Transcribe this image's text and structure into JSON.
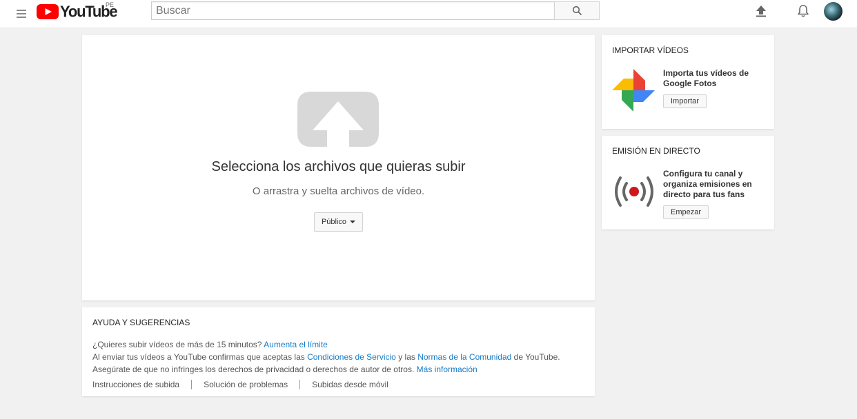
{
  "header": {
    "logo_text": "YouTube",
    "country_code": "PE",
    "search_placeholder": "Buscar",
    "search_value": ""
  },
  "upload": {
    "title": "Selecciona los archivos que quieras subir",
    "subtitle": "O arrastra y suelta archivos de vídeo.",
    "privacy_label": "Público"
  },
  "help": {
    "heading": "AYUDA Y SUGERENCIAS",
    "line1_text": "¿Quieres subir vídeos de más de 15 minutos?",
    "line1_link": "Aumenta el límite",
    "line2_a": "Al enviar tus vídeos a YouTube confirmas que aceptas las",
    "line2_link1": "Condiciones de Servicio",
    "line2_b": "y las",
    "line2_link2": "Normas de la Comunidad",
    "line2_c": "de YouTube.",
    "line3_text": "Asegúrate de que no infringes los derechos de privacidad o derechos de autor de otros.",
    "line3_link": "Más información",
    "links": [
      "Instrucciones de subida",
      "Solución de problemas",
      "Subidas desde móvil"
    ]
  },
  "import": {
    "heading": "IMPORTAR VÍDEOS",
    "text": "Importa tus vídeos de Google Fotos",
    "button": "Importar"
  },
  "live": {
    "heading": "EMISIÓN EN DIRECTO",
    "text": "Configura tu canal y organiza emisiones en directo para tus fans",
    "button": "Empezar"
  },
  "colors": {
    "brand_red": "#ff0000",
    "link_blue": "#167ac6",
    "live_red": "#cc181e"
  },
  "icons": [
    "menu-icon",
    "youtube-logo-icon",
    "search-icon",
    "upload-icon",
    "notifications-bell-icon",
    "google-photos-icon",
    "live-broadcast-icon"
  ]
}
